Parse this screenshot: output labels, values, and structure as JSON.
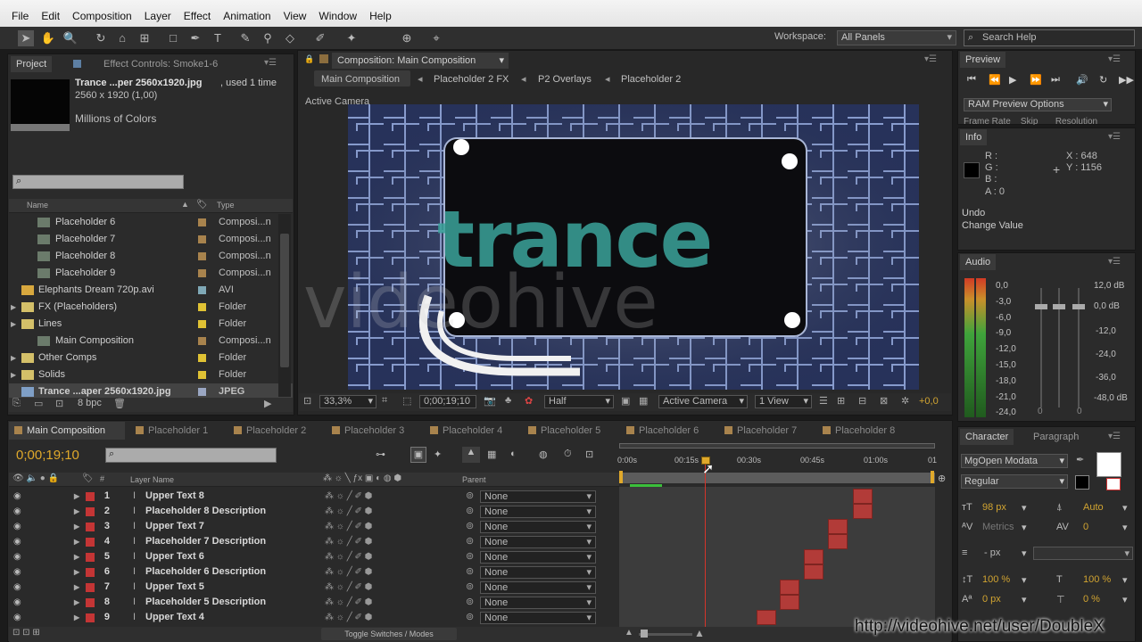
{
  "menu": [
    "File",
    "Edit",
    "Composition",
    "Layer",
    "Effect",
    "Animation",
    "View",
    "Window",
    "Help"
  ],
  "workspace": {
    "label": "Workspace:",
    "value": "All Panels",
    "search_placeholder": "Search Help"
  },
  "project_panel": {
    "tabs": [
      "Project",
      "Effect Controls: Smoke1-6"
    ],
    "preview_name": "Trance ...per 2560x1920.jpg",
    "preview_used": ", used 1 time",
    "preview_dims": "2560 x 1920 (1,00)",
    "preview_colors": "Millions of Colors",
    "columns": {
      "name": "Name",
      "type": "Type"
    },
    "items": [
      {
        "name": "Placeholder 6",
        "type": "Composi...n",
        "color": "#a8834d",
        "icon": "comp"
      },
      {
        "name": "Placeholder 7",
        "type": "Composi...n",
        "color": "#a8834d",
        "icon": "comp"
      },
      {
        "name": "Placeholder 8",
        "type": "Composi...n",
        "color": "#a8834d",
        "icon": "comp"
      },
      {
        "name": "Placeholder 9",
        "type": "Composi...n",
        "color": "#a8834d",
        "icon": "comp"
      },
      {
        "name": "Elephants Dream 720p.avi",
        "type": "AVI",
        "color": "#7fa8b6",
        "icon": "video"
      },
      {
        "name": "FX (Placeholders)",
        "type": "Folder",
        "color": "#e0c234",
        "icon": "folder"
      },
      {
        "name": "Lines",
        "type": "Folder",
        "color": "#e0c234",
        "icon": "folder"
      },
      {
        "name": "Main Composition",
        "type": "Composi...n",
        "color": "#a8834d",
        "icon": "comp"
      },
      {
        "name": "Other Comps",
        "type": "Folder",
        "color": "#e0c234",
        "icon": "folder"
      },
      {
        "name": "Solids",
        "type": "Folder",
        "color": "#e0c234",
        "icon": "folder"
      },
      {
        "name": "Trance ...aper 2560x1920.jpg",
        "type": "JPEG",
        "color": "#9aa6c2",
        "icon": "image"
      }
    ],
    "bpc": "8 bpc"
  },
  "composition": {
    "tab": "Composition: Main Composition",
    "breadcrumbs": [
      "Main Composition",
      "Placeholder 2 FX",
      "P2 Overlays",
      "Placeholder 2"
    ],
    "camera_label": "Active Camera",
    "viewer_text": "trance",
    "watermark": "videohive",
    "footer": {
      "zoom": "33,3%",
      "timecode": "0;00;19;10",
      "resolution": "Half",
      "camera": "Active Camera",
      "view": "1 View",
      "exposure": "+0,0"
    }
  },
  "preview": {
    "title": "Preview",
    "ram": "RAM Preview Options",
    "framerate": "Frame Rate",
    "skip": "Skip",
    "resolution": "Resolution"
  },
  "info": {
    "title": "Info",
    "r": "R :",
    "g": "G :",
    "b": "B :",
    "a": "A : 0",
    "x": "X : 648",
    "y": "Y : 1156",
    "undo": "Undo",
    "undo_action": "Change Value"
  },
  "audio": {
    "title": "Audio",
    "left_scale": [
      "0,0",
      "-3,0",
      "-6,0",
      "-9,0",
      "-12,0",
      "-15,0",
      "-18,0",
      "-21,0",
      "-24,0"
    ],
    "right_scale": [
      "12,0 dB",
      "0,0 dB",
      "-12,0",
      "-24,0",
      "-36,0",
      "-48,0 dB"
    ],
    "bottom": [
      "0",
      "0"
    ]
  },
  "character": {
    "tabs": [
      "Character",
      "Paragraph"
    ],
    "font": "MgOpen Modata",
    "style": "Regular",
    "size": "98 px",
    "leading": "Auto",
    "kerning": "Metrics",
    "tracking": "0",
    "stroke": "- px",
    "vscale": "100 %",
    "hscale": "100 %",
    "baseline": "0 px",
    "tsume": "0 %"
  },
  "timeline": {
    "active_tab": "Main Composition",
    "tabs": [
      "Placeholder 1",
      "Placeholder 2",
      "Placeholder 3",
      "Placeholder 4",
      "Placeholder 5",
      "Placeholder 6",
      "Placeholder 7",
      "Placeholder 8"
    ],
    "timecode": "0;00;19;10",
    "col_layer": "Layer Name",
    "col_parent": "Parent",
    "ruler": [
      "0:00s",
      "00:15s",
      "00:30s",
      "00:45s",
      "01:00s",
      "01"
    ],
    "layers": [
      {
        "num": "1",
        "name": "Upper Text 8",
        "parent": "None"
      },
      {
        "num": "2",
        "name": "Placeholder 8 Description",
        "parent": "None"
      },
      {
        "num": "3",
        "name": "Upper Text 7",
        "parent": "None"
      },
      {
        "num": "4",
        "name": "Placeholder 7 Description",
        "parent": "None"
      },
      {
        "num": "5",
        "name": "Upper Text 6",
        "parent": "None"
      },
      {
        "num": "6",
        "name": "Placeholder 6 Description",
        "parent": "None"
      },
      {
        "num": "7",
        "name": "Upper Text 5",
        "parent": "None"
      },
      {
        "num": "8",
        "name": "Placeholder 5 Description",
        "parent": "None"
      },
      {
        "num": "9",
        "name": "Upper Text 4",
        "parent": "None"
      }
    ],
    "toggle_label": "Toggle Switches / Modes"
  },
  "watermark_url": "http://videohive.net/user/DoubleX"
}
